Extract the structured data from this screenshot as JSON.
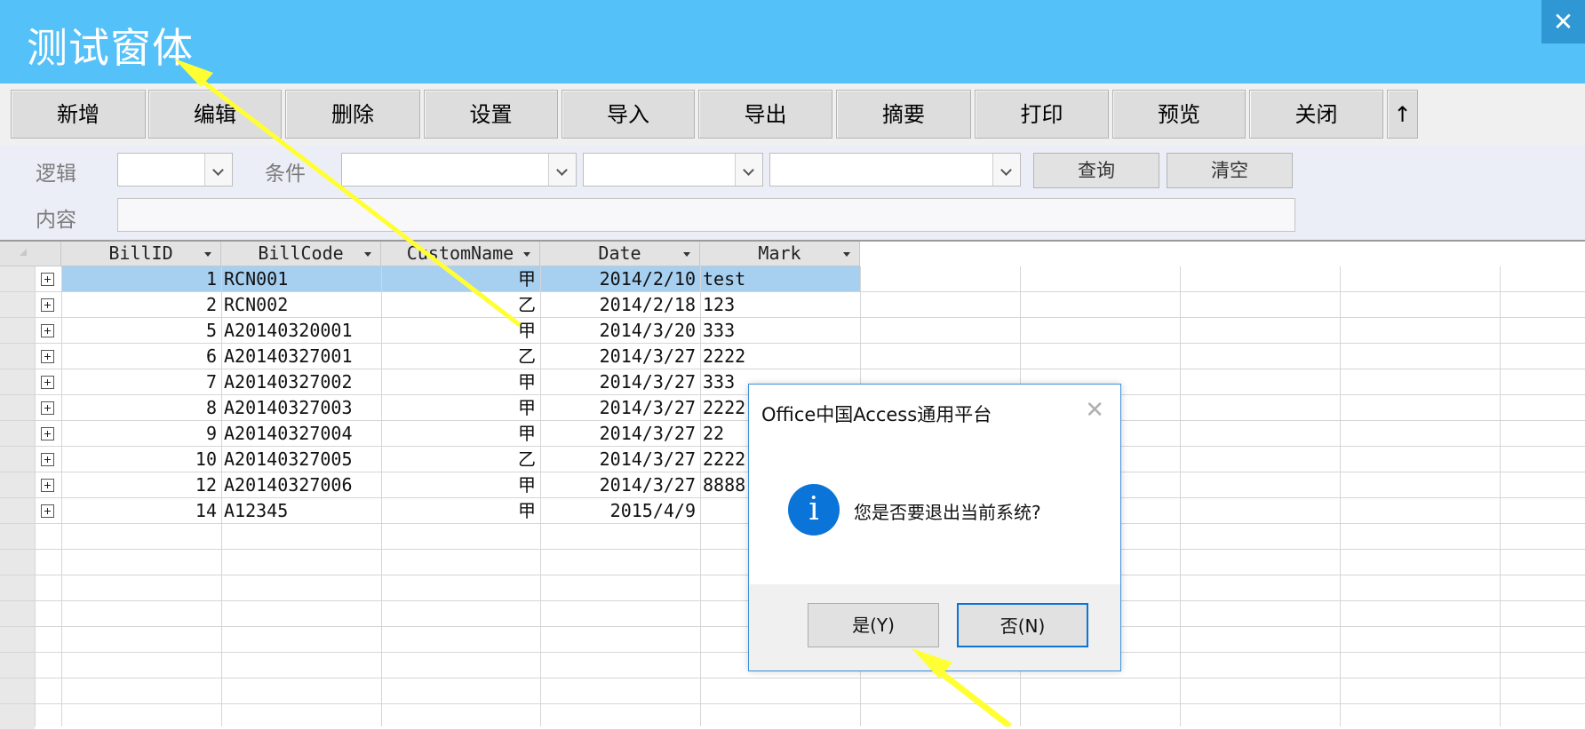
{
  "window": {
    "title": "测试窗体",
    "close_label": "✕"
  },
  "toolbar": {
    "buttons": [
      "新增",
      "编辑",
      "删除",
      "设置",
      "导入",
      "导出",
      "摘要",
      "打印",
      "预览",
      "关闭",
      "↑"
    ]
  },
  "filter": {
    "logic_label": "逻辑",
    "condition_label": "条件",
    "content_label": "内容",
    "query_button": "查询",
    "clear_button": "清空",
    "logic_value": "",
    "field_value": "",
    "operator_value": "",
    "condition_value": "",
    "content_value": ""
  },
  "grid": {
    "columns": [
      "BillID",
      "BillCode",
      "CustomName",
      "Date",
      "Mark"
    ],
    "rows": [
      [
        "1",
        "RCN001",
        "甲",
        "2014/2/10",
        "test"
      ],
      [
        "2",
        "RCN002",
        "乙",
        "2014/2/18",
        "123"
      ],
      [
        "5",
        "A20140320001",
        "甲",
        "2014/3/20",
        "333"
      ],
      [
        "6",
        "A20140327001",
        "乙",
        "2014/3/27",
        "2222"
      ],
      [
        "7",
        "A20140327002",
        "甲",
        "2014/3/27",
        "333"
      ],
      [
        "8",
        "A20140327003",
        "甲",
        "2014/3/27",
        "2222"
      ],
      [
        "9",
        "A20140327004",
        "甲",
        "2014/3/27",
        "22"
      ],
      [
        "10",
        "A20140327005",
        "乙",
        "2014/3/27",
        "2222"
      ],
      [
        "12",
        "A20140327006",
        "甲",
        "2014/3/27",
        "8888"
      ],
      [
        "14",
        "A12345",
        "甲",
        "2015/4/9",
        ""
      ]
    ]
  },
  "dialog": {
    "title": "Office中国Access通用平台",
    "close": "✕",
    "icon": "info-icon",
    "icon_glyph": "i",
    "message": "您是否要退出当前系统?",
    "yes_button": "是(Y)",
    "no_button": "否(N)"
  },
  "colors": {
    "title_bar": "#55c1f9",
    "selected_row": "#a7cff0",
    "dialog_accent": "#0b74d8",
    "annotation_arrow": "#ffff33"
  }
}
